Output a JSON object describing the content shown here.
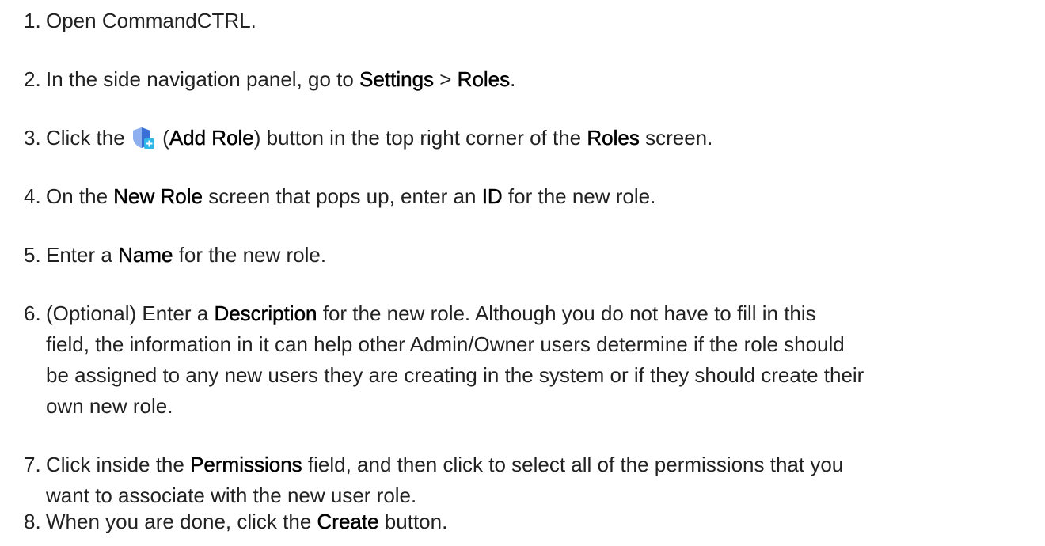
{
  "steps": [
    {
      "number": "1.",
      "parts": {
        "a": "Open CommandCTRL."
      }
    },
    {
      "number": "2.",
      "parts": {
        "a": "In the side navigation panel, go to ",
        "b": "Settings",
        "c": " > ",
        "d": "Roles",
        "e": "."
      }
    },
    {
      "number": "3.",
      "parts": {
        "a": "Click the ",
        "icon": "add-role-shield-icon",
        "b": " (",
        "c": "Add Role",
        "d": ") button in the top right corner of the ",
        "e": "Roles",
        "f": " screen."
      }
    },
    {
      "number": "4.",
      "parts": {
        "a": "On the ",
        "b": "New Role",
        "c": " screen that pops up, enter an ",
        "d": "ID",
        "e": " for the new role."
      }
    },
    {
      "number": "5.",
      "parts": {
        "a": "Enter a ",
        "b": "Name",
        "c": " for the new role."
      }
    },
    {
      "number": "6.",
      "parts": {
        "a": "(Optional) Enter a ",
        "b": "Description",
        "c": " for the new role. Although you do not have to fill in this",
        "l2": "field, the information in it can help other Admin/Owner users determine if the role should",
        "l3": "be assigned to any new users they are creating in the system or if they should create their",
        "l4": "own new role."
      }
    },
    {
      "number": "7.",
      "parts": {
        "a": "Click inside the ",
        "b": "Permissions",
        "c": " field, and then click to select all of the permissions that you",
        "l2": "want to associate with the new user role."
      }
    },
    {
      "number": "8.",
      "parts": {
        "a": "When you are done, click the ",
        "b": "Create",
        "c": " button."
      }
    }
  ],
  "colors": {
    "text": "#222222",
    "keyword": "#000000",
    "icon_shield": "#3b6fd8",
    "icon_plus_bg": "#2fb7e8"
  }
}
